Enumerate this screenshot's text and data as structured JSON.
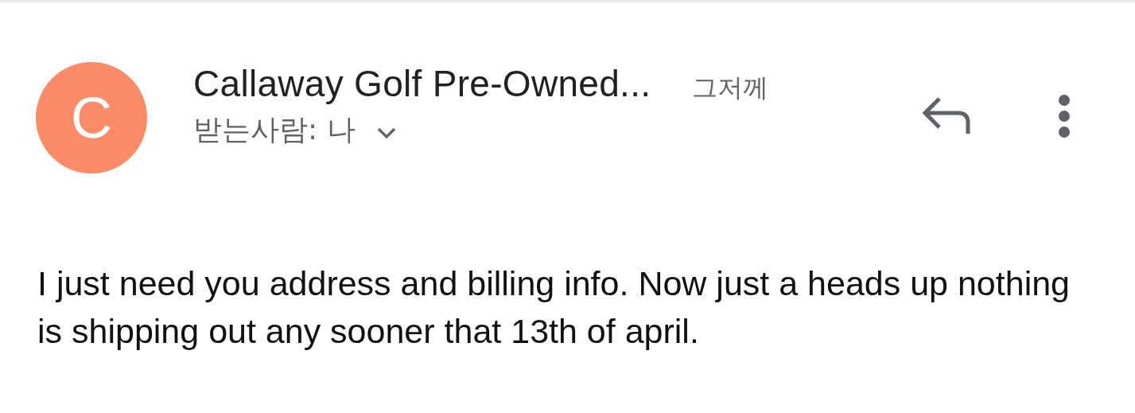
{
  "message": {
    "avatar": {
      "letter": "C",
      "color": "#fc8b68"
    },
    "sender": "Callaway Golf Pre-Owned...",
    "date": "그저께",
    "recipient": "받는사람: 나",
    "body": "I just need you address and billing info. Now just a heads up nothing is shipping out any sooner that 13th of april."
  }
}
